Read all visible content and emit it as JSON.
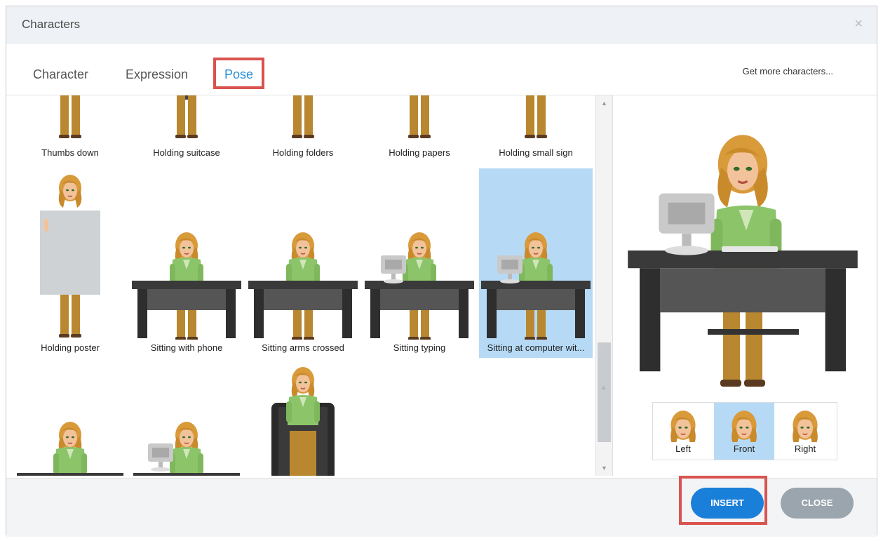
{
  "dialog": {
    "title": "Characters",
    "close_glyph": "×"
  },
  "tabs": [
    {
      "label": "Character"
    },
    {
      "label": "Expression"
    },
    {
      "label": "Pose",
      "active": true
    }
  ],
  "get_more": "Get more characters...",
  "poses": [
    {
      "label": "Thumbs down"
    },
    {
      "label": "Holding suitcase"
    },
    {
      "label": "Holding folders"
    },
    {
      "label": "Holding papers"
    },
    {
      "label": "Holding small sign"
    },
    {
      "label": "Holding poster"
    },
    {
      "label": "Sitting with phone"
    },
    {
      "label": "Sitting arms crossed"
    },
    {
      "label": "Sitting typing"
    },
    {
      "label": "Sitting at computer wit...",
      "selected": true
    }
  ],
  "directions": [
    {
      "label": "Left"
    },
    {
      "label": "Front",
      "selected": true
    },
    {
      "label": "Right"
    }
  ],
  "buttons": {
    "insert": "INSERT",
    "close": "CLOSE"
  },
  "colors": {
    "accent": "#1a7fd9",
    "selection": "#b6daf6",
    "highlight_box": "#d9534f",
    "pants": "#b8872f",
    "jacket": "#8cc46a",
    "hair": "#d99a3a",
    "skin": "#f2c29a",
    "desk": "#3a3a3a"
  }
}
